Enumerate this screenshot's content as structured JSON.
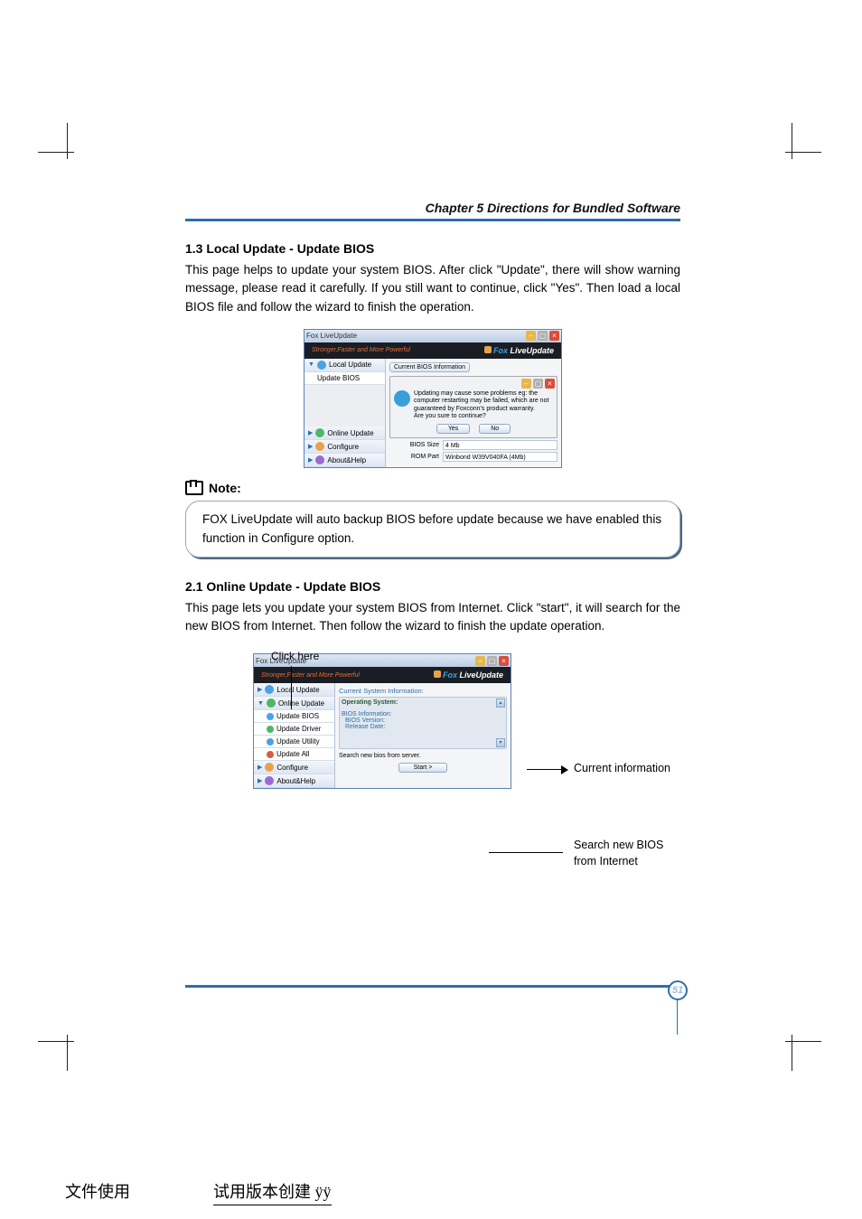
{
  "chapter_header": "Chapter 5    Directions for Bundled Software",
  "section1": {
    "title": "1.3 Local Update - Update BIOS",
    "body": "This page helps to update your system BIOS.  After click \"Update\", there will show warning message, please read it carefully. If you still want to continue, click \"Yes\". Then load a local BIOS file and follow the wizard to finish the operation."
  },
  "screenshot1": {
    "title": "Fox LiveUpdate",
    "slogan": "Stronger,Faster and More Powerful",
    "brand_prefix": "Fox",
    "brand_suffix": " LiveUpdate",
    "nav": {
      "local_update": "Local Update",
      "update_bios": "Update BIOS",
      "online_update": "Online Update",
      "configure": "Configure",
      "about_help": "About&Help"
    },
    "tab_label": "Current BIOS Information",
    "dialog_text": "Updating may cause some problems eg: the computer restarting may be failed, which are not guaranteed by Foxconn's product warranty.",
    "dialog_prompt": "Are you sure to continue?",
    "yes": "Yes",
    "no": "No",
    "rows": {
      "bios_size_label": "BIOS Size",
      "bios_size_value": "4 Mb",
      "rom_part_label": "ROM Part",
      "rom_part_value": "Winbond W39V040FA (4Mb)"
    }
  },
  "note_label": "Note:",
  "note_text": "FOX LiveUpdate will auto backup BIOS before update because we have enabled this function in Configure option.",
  "section2": {
    "title": "2.1 Online Update - Update BIOS",
    "body": "This page lets you update your system BIOS from Internet. Click \"start\", it will search for  the new BIOS from Internet. Then follow the wizard to finish the update operation."
  },
  "screenshot2": {
    "title": "Fox LiveUpdate",
    "slogan": "Stronger,Faster and More Powerful",
    "brand_prefix": "Fox",
    "brand_suffix": " LiveUpdate",
    "nav": {
      "local_update": "Local Update",
      "online_update": "Online Update",
      "update_bios": "Update BIOS",
      "update_driver": "Update Driver",
      "update_utility": "Update Utility",
      "update_all": "Update All",
      "configure": "Configure",
      "about_help": "About&Help"
    },
    "main_heading": "Current System Information:",
    "os_label": "Operating System:",
    "info_line1": "BIOS Information:",
    "info_line2": "BIOS Version:",
    "info_line3": "Release Date:",
    "search_label": "Search new bios from server.",
    "start_button": "Start  >"
  },
  "callouts": {
    "click_here": "Click here",
    "current_info": "Current information",
    "search_bios_l1": "Search new BIOS",
    "search_bios_l2": "from Internet"
  },
  "page_number": "51",
  "bottom": {
    "left": "文件使用",
    "mid": " 试用版本创建 ÿÿ"
  }
}
